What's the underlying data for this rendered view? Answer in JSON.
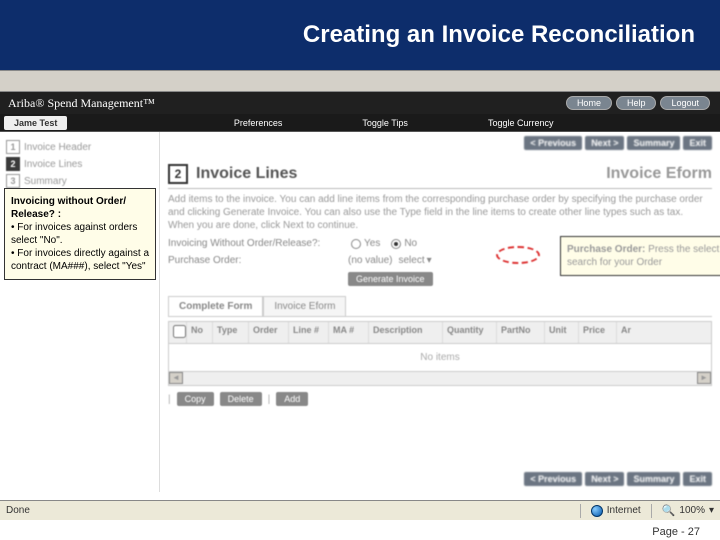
{
  "title": "Creating an Invoice Reconciliation",
  "brand": "Ariba® Spend Management™",
  "top_buttons": [
    "Home",
    "Help",
    "Logout"
  ],
  "menu": {
    "user": "Jame Test",
    "items": [
      "Preferences",
      "Toggle Tips",
      "Toggle Currency"
    ]
  },
  "steps": [
    {
      "num": "1",
      "label": "Invoice Header"
    },
    {
      "num": "2",
      "label": "Invoice Lines"
    },
    {
      "num": "3",
      "label": "Summary"
    }
  ],
  "nav": {
    "prev": "< Previous",
    "next": "Next >",
    "summary": "Summary",
    "exit": "Exit"
  },
  "section": {
    "num": "2",
    "title": "Invoice Lines",
    "eform": "Invoice Eform"
  },
  "desc": "Add items to the invoice. You can add line items from the corresponding purchase order by specifying the purchase order and clicking Generate Invoice. You can also use the Type field in the line items to create other line types such as tax. When you are done, click Next to continue.",
  "fields": {
    "q_label": "Invoicing Without Order/Release?:",
    "yes": "Yes",
    "no": "No",
    "po_label": "Purchase Order:",
    "po_value": "(no value)",
    "select": "select",
    "generate": "Generate Invoice"
  },
  "tabs": [
    "Complete Form",
    "Invoice Eform"
  ],
  "grid_cols": [
    "",
    "No",
    "Type",
    "Order",
    "Line #",
    "MA #",
    "Description",
    "Quantity",
    "PartNo",
    "Unit",
    "Price",
    "Ar"
  ],
  "grid_empty": "No items",
  "actions": {
    "copy": "Copy",
    "delete": "Delete",
    "add": "Add"
  },
  "callout_left": {
    "heading": "Invoicing without Order/ Release? :",
    "b1": "• For invoices against orders select \"No\".",
    "b2": "• For invoices directly against a contract (MA###), select \"Yes\""
  },
  "callout_right": {
    "heading": "Purchase Order:",
    "body": " Press the select button the search for your Order"
  },
  "status": {
    "done": "Done",
    "zone": "Internet",
    "zoom": "100%"
  },
  "footer": "Page - 27"
}
